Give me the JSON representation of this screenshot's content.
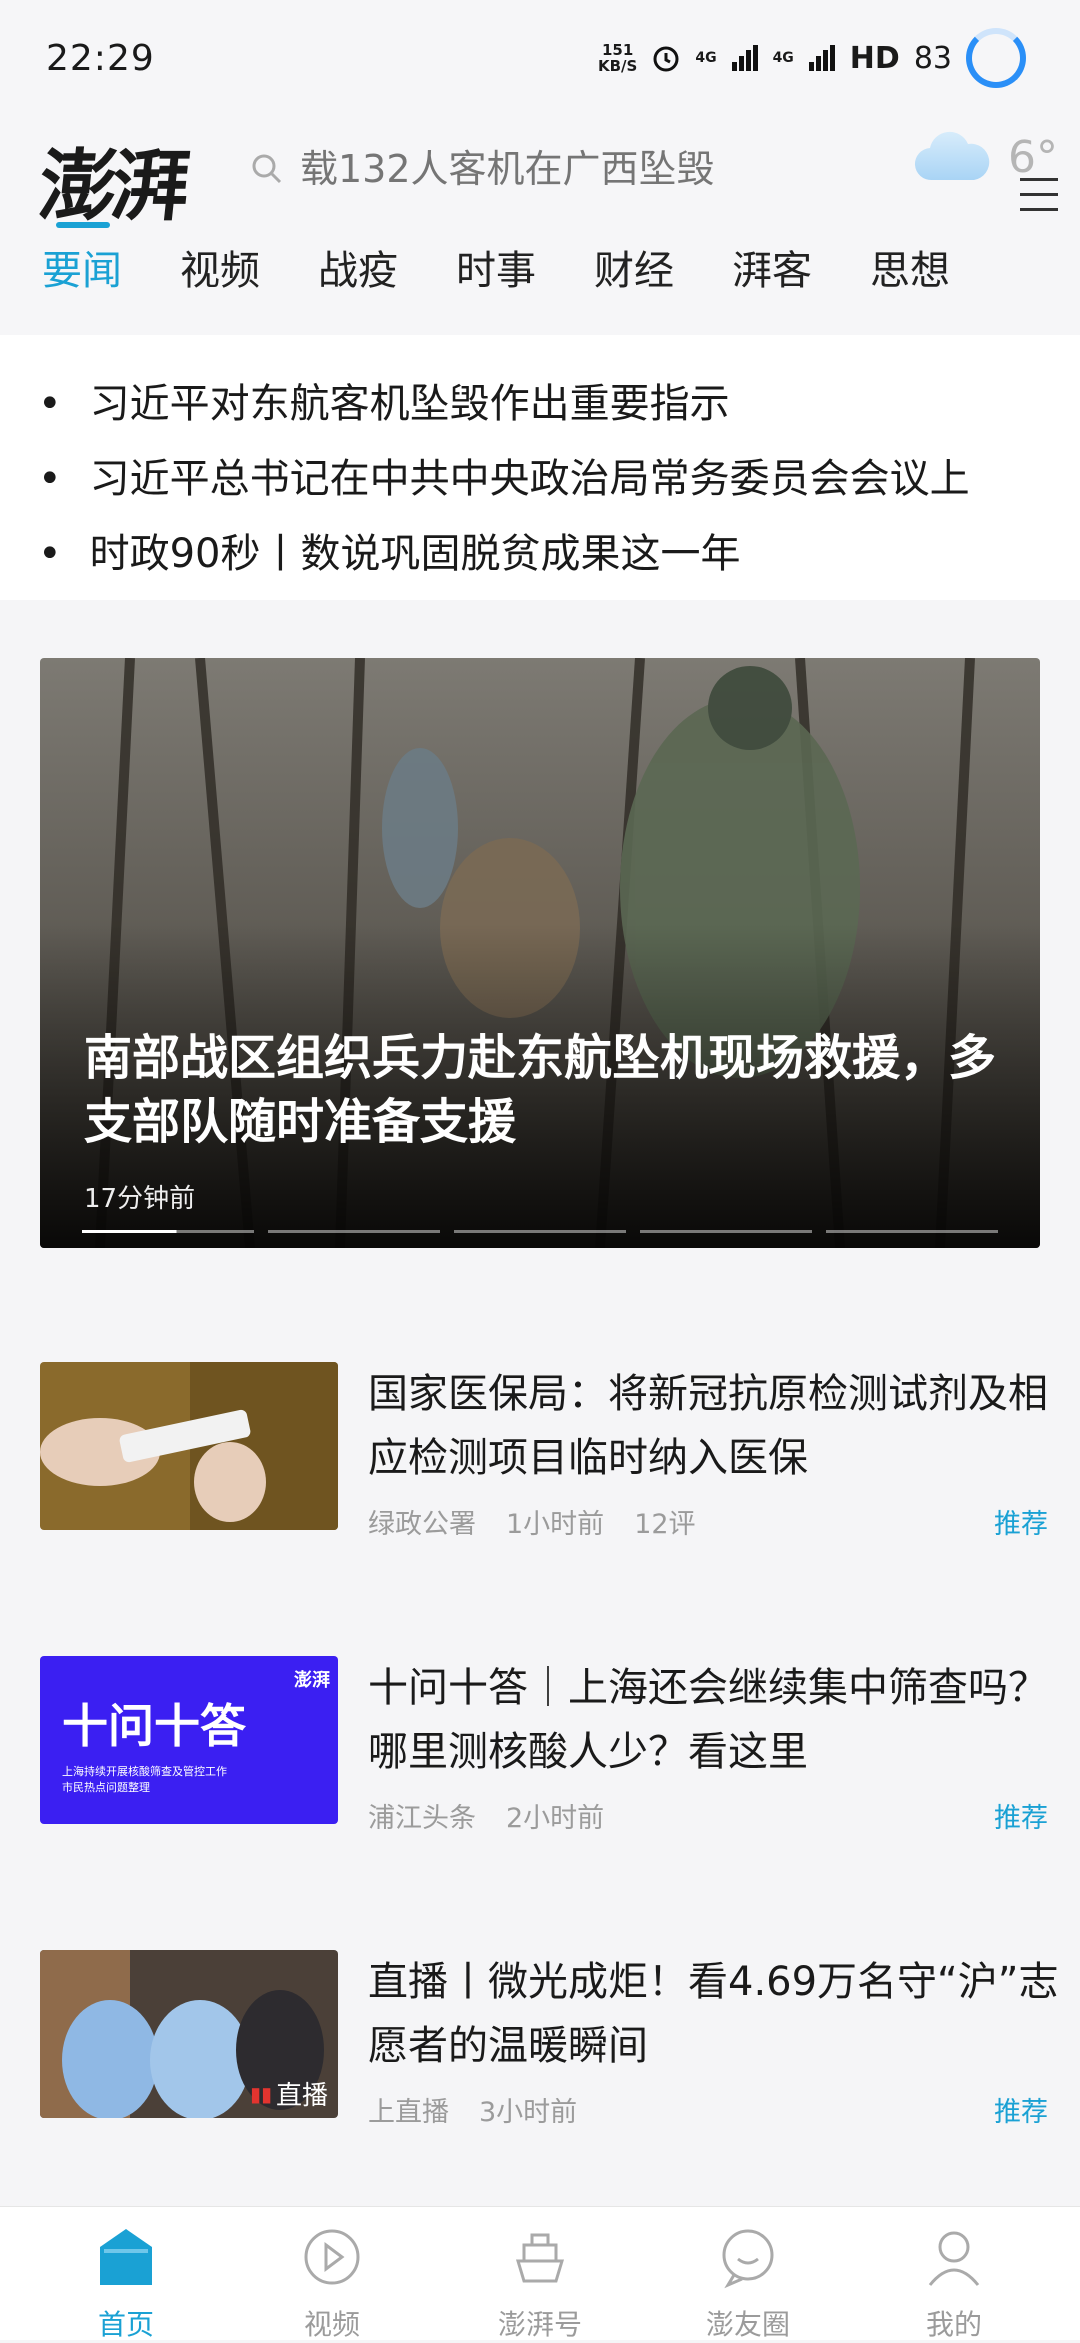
{
  "status_bar": {
    "time": "22:29",
    "network_speed": "151\nKB/S",
    "net_top": "151",
    "net_bottom": "KB/S",
    "signal1": "4G",
    "signal2": "4G",
    "hd": "HD",
    "battery": "83"
  },
  "header": {
    "logo": "澎湃",
    "search_placeholder": "载132人客机在广西坠毁",
    "temperature": "6°"
  },
  "tabs": [
    "要闻",
    "视频",
    "战疫",
    "时事",
    "财经",
    "湃客",
    "思想"
  ],
  "headlines": [
    "习近平对东航客机坠毁作出重要指示",
    "习近平总书记在中共中央政治局常务委员会会议上",
    "时政90秒丨数说巩固脱贫成果这一年"
  ],
  "hero": {
    "title": "南部战区组织兵力赴东航坠机现场救援，多支部队随时准备支援",
    "time": "17分钟前",
    "pages": 5,
    "current_page": 1
  },
  "articles": [
    {
      "title": "国家医保局：将新冠抗原检测试剂及相应检测项目临时纳入医保",
      "source": "绿政公署",
      "time": "1小时前",
      "comments": "12评",
      "tag": "推荐"
    },
    {
      "title": "十问十答｜上海还会继续集中筛查吗？哪里测核酸人少？看这里",
      "source": "浦江头条",
      "time": "2小时前",
      "comments": "",
      "tag": "推荐",
      "thumb_title": "十问十答",
      "thumb_sub1": "上海持续开展核酸筛查及管控工作",
      "thumb_sub2": "市民热点问题整理",
      "thumb_logo": "澎湃"
    },
    {
      "title": "直播丨微光成炬！看4.69万名守“沪”志愿者的温暖瞬间",
      "source": "上直播",
      "time": "3小时前",
      "comments": "",
      "tag": "推荐",
      "live_badge": "直播"
    }
  ],
  "bottom_nav": [
    "首页",
    "视频",
    "澎湃号",
    "澎友圈",
    "我的"
  ],
  "colors": {
    "accent": "#1aa1d4",
    "battery_ring": "#2a8ff7",
    "promo_bg": "#3b1ff2"
  }
}
